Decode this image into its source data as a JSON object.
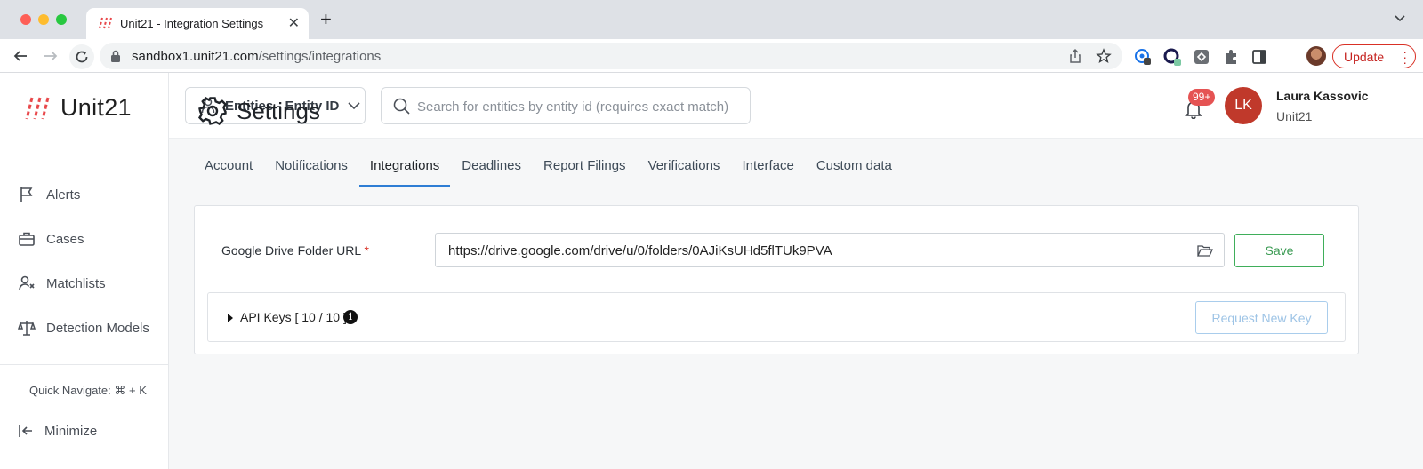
{
  "browser": {
    "tab_title": "Unit21 - Integration Settings",
    "url_host": "sandbox1.unit21.com",
    "url_path": "/settings/integrations",
    "update_label": "Update"
  },
  "app": {
    "logo_text": "Unit21",
    "sidebar": {
      "items": [
        {
          "label": "Alerts",
          "icon": "flag-icon"
        },
        {
          "label": "Cases",
          "icon": "briefcase-icon"
        },
        {
          "label": "Matchlists",
          "icon": "user-x-icon"
        },
        {
          "label": "Detection Models",
          "icon": "scale-icon"
        }
      ],
      "quick_navigate": "Quick Navigate: ⌘ + K",
      "minimize": "Minimize"
    },
    "topbar": {
      "entity_select": "Entities - Entity ID",
      "search_placeholder": "Search for entities by entity id (requires exact match)",
      "notification_count": "99+",
      "user_initials": "LK",
      "user_name": "Laura Kassovic",
      "user_org": "Unit21"
    }
  },
  "settings": {
    "title": "Settings",
    "tabs": [
      {
        "label": "Account",
        "active": false
      },
      {
        "label": "Notifications",
        "active": false
      },
      {
        "label": "Integrations",
        "active": true
      },
      {
        "label": "Deadlines",
        "active": false
      },
      {
        "label": "Report Filings",
        "active": false
      },
      {
        "label": "Verifications",
        "active": false
      },
      {
        "label": "Interface",
        "active": false
      },
      {
        "label": "Custom data",
        "active": false
      }
    ],
    "gdrive_label": "Google Drive Folder URL",
    "gdrive_required": "*",
    "gdrive_value": "https://drive.google.com/drive/u/0/folders/0AJiKsUHd5flTUk9PVA",
    "save_label": "Save",
    "api_keys_label": "API Keys",
    "api_keys_count": "[ 10 / 10 ]",
    "request_key_label": "Request New Key"
  },
  "colors": {
    "accent_blue": "#2e7dd4",
    "save_green": "#3fae5a",
    "badge_red": "#e55353",
    "avatar_red": "#c0392b"
  }
}
